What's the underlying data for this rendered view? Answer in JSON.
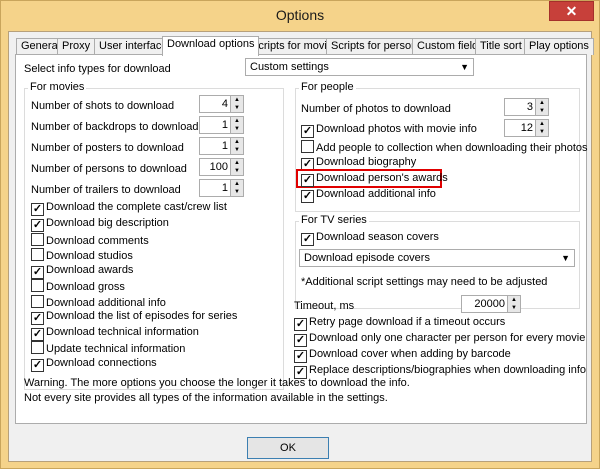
{
  "window": {
    "title": "Options",
    "close_glyph": "✕"
  },
  "tabs": [
    {
      "label": "General"
    },
    {
      "label": "Proxy"
    },
    {
      "label": "User interface"
    },
    {
      "label": "Download options"
    },
    {
      "label": "Scripts for movies"
    },
    {
      "label": "Scripts for persons"
    },
    {
      "label": "Custom fields"
    },
    {
      "label": "Title sort"
    },
    {
      "label": "Play options"
    }
  ],
  "info_types": {
    "label": "Select info types for download",
    "value": "Custom settings"
  },
  "movies": {
    "title": "For movies",
    "spinners": [
      {
        "label": "Number of shots to download",
        "value": "4"
      },
      {
        "label": "Number of backdrops to download",
        "value": "1"
      },
      {
        "label": "Number of posters to download",
        "value": "1"
      },
      {
        "label": "Number of persons to download",
        "value": "100"
      },
      {
        "label": "Number of trailers to download",
        "value": "1"
      }
    ],
    "checks": [
      {
        "label": "Download the complete cast/crew list",
        "mark": "✓"
      },
      {
        "label": "Download big description",
        "mark": "✓"
      },
      {
        "label": "Download comments",
        "mark": ""
      },
      {
        "label": "Download studios",
        "mark": ""
      },
      {
        "label": "Download awards",
        "mark": "✓"
      },
      {
        "label": "Download gross",
        "mark": ""
      },
      {
        "label": "Download additional info",
        "mark": ""
      },
      {
        "label": "Download the list of episodes for series",
        "mark": "✓"
      },
      {
        "label": "Download technical information",
        "mark": "✓"
      },
      {
        "label": "Update technical information",
        "mark": ""
      },
      {
        "label": "Download connections",
        "mark": "✓"
      }
    ]
  },
  "people": {
    "title": "For people",
    "photos": {
      "label": "Number of photos to download",
      "value": "3"
    },
    "photos_movie": {
      "label": "Download photos with movie info",
      "mark": "✓",
      "value": "12"
    },
    "checks": [
      {
        "label": "Add people to collection when downloading their photos",
        "mark": ""
      },
      {
        "label": "Download biography",
        "mark": "✓"
      },
      {
        "label": "Download person's awards",
        "mark": "✓"
      },
      {
        "label": "Download additional info",
        "mark": "✓"
      }
    ]
  },
  "tv": {
    "title": "For TV series",
    "season": {
      "label": "Download season covers",
      "mark": "✓"
    },
    "episode_select": "Download episode covers",
    "note": "*Additional script settings may need to be adjusted"
  },
  "timeout": {
    "label": "Timeout, ms",
    "value": "20000"
  },
  "misc": [
    {
      "label": "Retry page download if a timeout occurs",
      "mark": "✓"
    },
    {
      "label": "Download only one character per person for every movie",
      "mark": "✓"
    },
    {
      "label": "Download cover when adding by barcode",
      "mark": "✓"
    },
    {
      "label": "Replace descriptions/biographies when downloading info",
      "mark": "✓"
    }
  ],
  "warning": [
    "Warning. The more options you choose the longer it takes to download the info.",
    "Not every site provides all types of the information available in the settings."
  ],
  "ok_label": "OK",
  "colors": {
    "frame": "#f5d38a",
    "close": "#c7403a",
    "highlight": "#e00000"
  }
}
